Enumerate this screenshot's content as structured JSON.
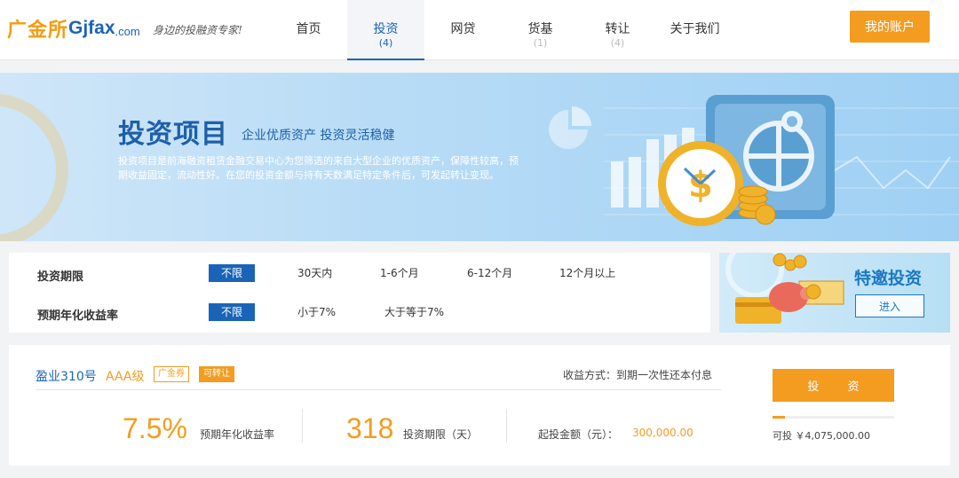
{
  "header": {
    "logo_cn": "广金所",
    "logo_en": "Gjfax",
    "logo_dot": ".com",
    "slogan": "身边的投融资专家!",
    "nav": [
      {
        "label": "首页",
        "count": ""
      },
      {
        "label": "投资",
        "count": "(4)"
      },
      {
        "label": "网贷",
        "count": ""
      },
      {
        "label": "货基",
        "count": "(1)"
      },
      {
        "label": "转让",
        "count": "(4)"
      },
      {
        "label": "关于我们",
        "count": ""
      }
    ],
    "active_nav": "投资",
    "account_button": "我的账户"
  },
  "banner": {
    "title": "投资项目",
    "subtitle": "企业优质资产  投资灵活稳健",
    "description": "投资项目是前海融资租赁金融交易中心为您筛选的来自大型企业的优质资产，保障性较高，预期收益固定，流动性好。在您的投资金额与持有天数满足特定条件后，可发起转让变现。"
  },
  "filters": {
    "period": {
      "label": "投资期限",
      "options": [
        "不限",
        "30天内",
        "1-6个月",
        "6-12个月",
        "12个月以上"
      ],
      "selected": "不限"
    },
    "rate": {
      "label": "预期年化收益率",
      "options": [
        "不限",
        "小于7%",
        "大于等于7%"
      ],
      "selected": "不限"
    }
  },
  "promo": {
    "title": "特邀投资",
    "button": "进入"
  },
  "product": {
    "name": "盈业310号",
    "grade": "AAA级",
    "tag_coupon": "广金券",
    "tag_transfer": "可转让",
    "repayment": "收益方式：到期一次性还本付息",
    "rate_value": "7.5%",
    "rate_label": "预期年化收益率",
    "period_value": "318",
    "period_label": "投资期限（天）",
    "min_label": "起投金额（元）：",
    "min_value": "300,000.00",
    "invest_button": "投 资",
    "progress_fraction": 0.1,
    "available": "可投 ￥4,075,000.00"
  },
  "colors": {
    "brand_blue": "#1a64b8",
    "accent_orange": "#f39c1f"
  }
}
